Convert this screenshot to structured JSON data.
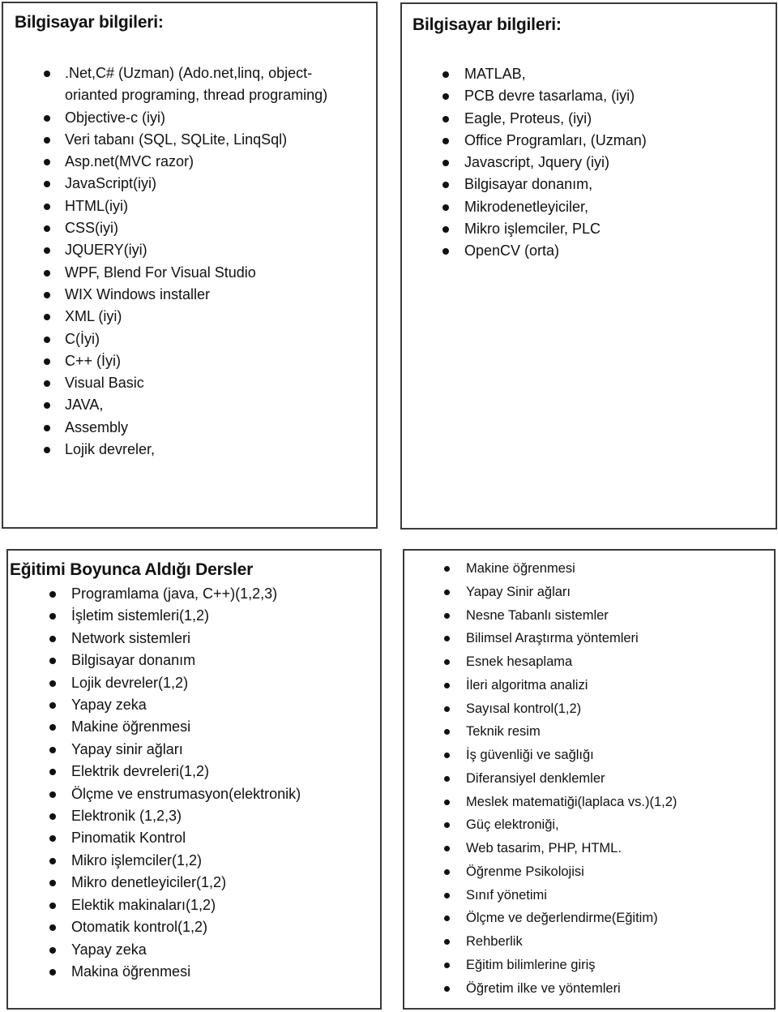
{
  "computer_skills_1": {
    "title": "Bilgisayar bilgileri:",
    "items": [
      ".Net,C# (Uzman) (Ado.net,linq, object-orianted programing, thread programing)",
      "Objective-c (iyi)",
      "Veri tabanı (SQL, SQLite, LinqSql)",
      "Asp.net(MVC razor)",
      "JavaScript(iyi)",
      "HTML(iyi)",
      "CSS(iyi)",
      "JQUERY(iyi)",
      "WPF, Blend For Visual Studio",
      "WIX Windows installer",
      "XML (iyi)",
      "C(İyi)",
      "C++ (İyi)",
      "Visual Basic",
      "JAVA,",
      "Assembly",
      "Lojik devreler,"
    ]
  },
  "computer_skills_2": {
    "title": "Bilgisayar bilgileri:",
    "items": [
      "MATLAB,",
      "PCB devre tasarlama, (iyi)",
      "Eagle, Proteus, (iyi)",
      "Office Programları, (Uzman)",
      "Javascript, Jquery (iyi)",
      "Bilgisayar donanım,",
      "Mikrodenetleyiciler,",
      "Mikro işlemciler, PLC",
      "OpenCV (orta)"
    ]
  },
  "courses_1": {
    "title": "Eğitimi Boyunca Aldığı Dersler",
    "items": [
      "Programlama (java, C++)(1,2,3)",
      "İşletim sistemleri(1,2)",
      "Network sistemleri",
      "Bilgisayar donanım",
      "Lojik devreler(1,2)",
      "Yapay zeka",
      "Makine öğrenmesi",
      "Yapay sinir ağları",
      "Elektrik devreleri(1,2)",
      "Ölçme ve enstrumasyon(elektronik)",
      "Elektronik (1,2,3)",
      "Pinomatik Kontrol",
      "Mikro işlemciler(1,2)",
      "Mikro denetleyiciler(1,2)",
      "Elektik makinaları(1,2)",
      "Otomatik kontrol(1,2)",
      "Yapay zeka",
      "Makina öğrenmesi"
    ]
  },
  "courses_2": {
    "items": [
      "Makine öğrenmesi",
      "Yapay Sinir ağları",
      "Nesne Tabanlı sistemler",
      "Bilimsel Araştırma yöntemleri",
      "Esnek hesaplama",
      "İleri algoritma analizi",
      "Sayısal kontrol(1,2)",
      "Teknik resim",
      "İş güvenliği ve sağlığı",
      "Diferansiyel denklemler",
      "Meslek matematiği(laplaca vs.)(1,2)",
      "Güç elektroniği,",
      "Web tasarim, PHP, HTML.",
      "Öğrenme Psikolojisi",
      "Sınıf yönetimi",
      "Ölçme ve değerlendirme(Eğitim)",
      "Rehberlik",
      "Eğitim bilimlerine giriş",
      "Öğretim ilke ve yöntemleri"
    ]
  }
}
